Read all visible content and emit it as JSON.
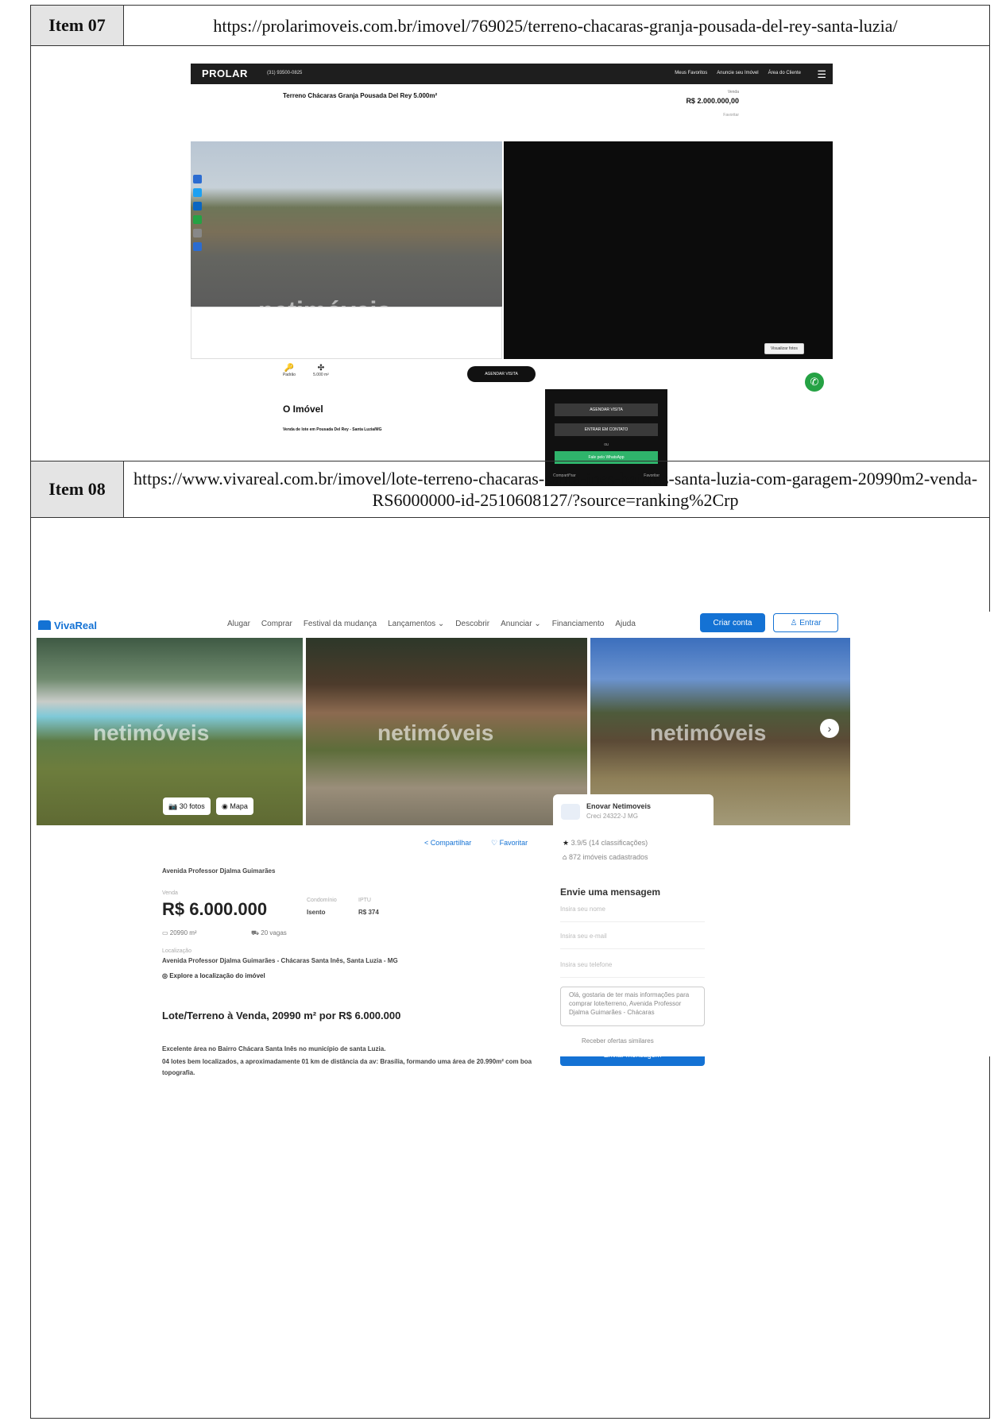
{
  "item07": {
    "label": "Item 07",
    "url": "https://prolarimoveis.com.br/imovel/769025/terreno-chacaras-granja-pousada-del-rey-santa-luzia/",
    "screenshot": {
      "logo": "PROLAR",
      "phone": "(31) 93500-0825",
      "nav": [
        "Meus Favoritos",
        "Anuncie seu Imóvel",
        "Área do Cliente"
      ],
      "title": "Terreno Chácaras Granja Pousada Del Rey 5.000m²",
      "sale_label": "Venda",
      "price": "R$ 2.000.000,00",
      "favorite": "Favoritar",
      "watermark": "netimóveis",
      "view_photos": "Visualizar fotos",
      "features": [
        "Padrão",
        "5.000 m²"
      ],
      "schedule": "AGENDAR VISITA",
      "section_title": "O Imóvel",
      "subheading": "Venda de lote em Pousada Del Rey - Santa Luzia/MG",
      "panel_buttons": [
        "AGENDAR VISITA",
        "ENTRAR EM CONTATO",
        "ou",
        "Fale pelo WhatsApp"
      ],
      "panel_footer": [
        "Compartilhar",
        "Favoritar"
      ]
    }
  },
  "item08": {
    "label": "Item 08",
    "url": "https://www.vivareal.com.br/imovel/lote-terreno-chacaras-santa-ines-bairros-santa-luzia-com-garagem-20990m2-venda-RS6000000-id-2510608127/?source=ranking%2Crp",
    "screenshot": {
      "logo": "VivaReal",
      "nav": [
        "Alugar",
        "Comprar",
        "Festival da mudança",
        "Lançamentos ⌄",
        "Descobrir",
        "Anunciar ⌄",
        "Financiamento",
        "Ajuda"
      ],
      "create_account": "Criar conta",
      "login": "Entrar",
      "photos_btn": "30 fotos",
      "map_btn": "Mapa",
      "watermark": "netimóveis",
      "agent_name": "Enovar Netimoveis",
      "agent_creci": "Creci 24322-J MG",
      "share": "Compartilhar",
      "favorite": "Favoritar",
      "rating": "3.9/5 (14 classificações)",
      "listings": "872 imóveis cadastrados",
      "breadcrumb_street": "Avenida Professor Djalma Guimarães",
      "sale_label": "Venda",
      "price": "R$ 6.000.000",
      "condo_label": "Condomínio",
      "condo_value": "Isento",
      "iptu_label": "IPTU",
      "iptu_value": "R$ 374",
      "area": "20990 m²",
      "spots": "20 vagas",
      "location_label": "Localização",
      "address": "Avenida Professor Djalma Guimarães - Chácaras Santa Inês, Santa Luzia - MG",
      "explore": "Explore a localização do imóvel",
      "heading": "Lote/Terreno à Venda, 20990 m² por R$ 6.000.000",
      "desc1": "Excelente área no Bairro Chácara Santa Inês no município de santa Luzia.",
      "desc2": "04 lotes bem localizados, a aproximadamente 01 km de distância da av: Brasília, formando uma área de 20.990m² com boa topografia.",
      "message_title": "Envie uma mensagem",
      "name_ph": "Insira seu nome",
      "email_ph": "Insira seu e-mail",
      "phone_ph": "Insira seu telefone",
      "message_text": "Olá, gostaria de ter mais informações para comprar lote/terreno, Avenida Professor Djalma Guimarães - Chácaras",
      "similar": "Receber ofertas similares",
      "send": "Enviar mensagem"
    }
  }
}
